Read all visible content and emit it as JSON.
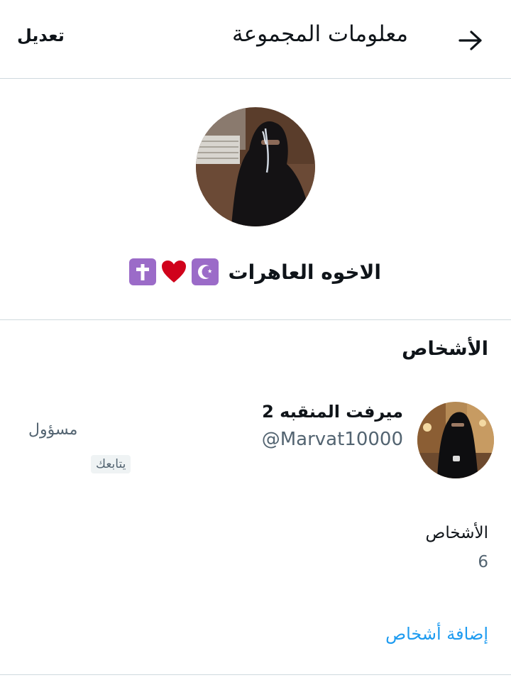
{
  "header": {
    "title": "معلومات المجموعة",
    "edit_label": "تعديل"
  },
  "group": {
    "name": "الاخوه العاهرات",
    "emoji_icons": [
      "crescent-star-icon",
      "red-heart-icon",
      "latin-cross-icon"
    ]
  },
  "people_section": {
    "title": "الأشخاص",
    "members": [
      {
        "name": "ميرفت المنقبه 2",
        "handle": "@Marvat10000",
        "role": "مسؤول",
        "follows_badge": "يتابعك"
      }
    ],
    "count_label": "الأشخاص",
    "count_value": "6",
    "add_people_label": "إضافة أشخاص"
  },
  "colors": {
    "accent": "#1d9bf0",
    "secondary_text": "#536471",
    "divider": "#cfd9de",
    "emoji_purple": "#9b6bc8",
    "heart_red": "#d0021b"
  }
}
